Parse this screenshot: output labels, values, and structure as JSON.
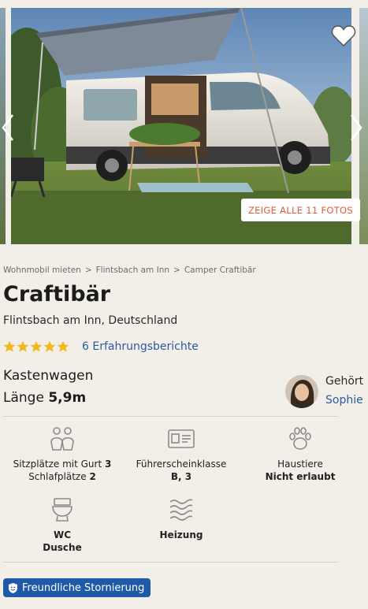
{
  "gallery": {
    "show_all_label": "ZEIGE ALLE 11 FOTOS",
    "icons": [
      "heart-icon",
      "chevron-left-icon",
      "chevron-right-icon"
    ]
  },
  "breadcrumb": [
    "Wohnmobil mieten",
    "Flintsbach am Inn",
    "Camper Craftibär"
  ],
  "listing": {
    "title": "Craftibär",
    "location": "Flintsbach am Inn, Deutschland",
    "rating_stars": 5,
    "reviews_label": "6 Erfahrungsberichte",
    "vehicle_type": "Kastenwagen",
    "length_label": "Länge",
    "length_value": "5,9m"
  },
  "owner": {
    "label": "Gehört",
    "name": "Sophie"
  },
  "features": [
    {
      "icon": "people-icon",
      "line1_prefix": "Sitzplätze mit Gurt",
      "line1_value": "3",
      "line2_prefix": "Schlafplätze",
      "line2_value": "2"
    },
    {
      "icon": "license-card-icon",
      "line1": "Führerscheinklasse",
      "line2": "B, 3"
    },
    {
      "icon": "paw-icon",
      "line1": "Haustiere",
      "line2": "Nicht erlaubt"
    },
    {
      "icon": "toilet-icon",
      "line1": "WC",
      "line2": "Dusche"
    },
    {
      "icon": "heating-icon",
      "line1": "Heizung"
    }
  ],
  "badge": {
    "label": "Freundliche Stornierung",
    "icon": "shield-icon"
  },
  "colors": {
    "background": "#f2efe8",
    "link": "#2c5aa0",
    "accent": "#e3573b",
    "star": "#f0b91c",
    "badge": "#1f5aa8",
    "icon": "#8a8a8a"
  }
}
